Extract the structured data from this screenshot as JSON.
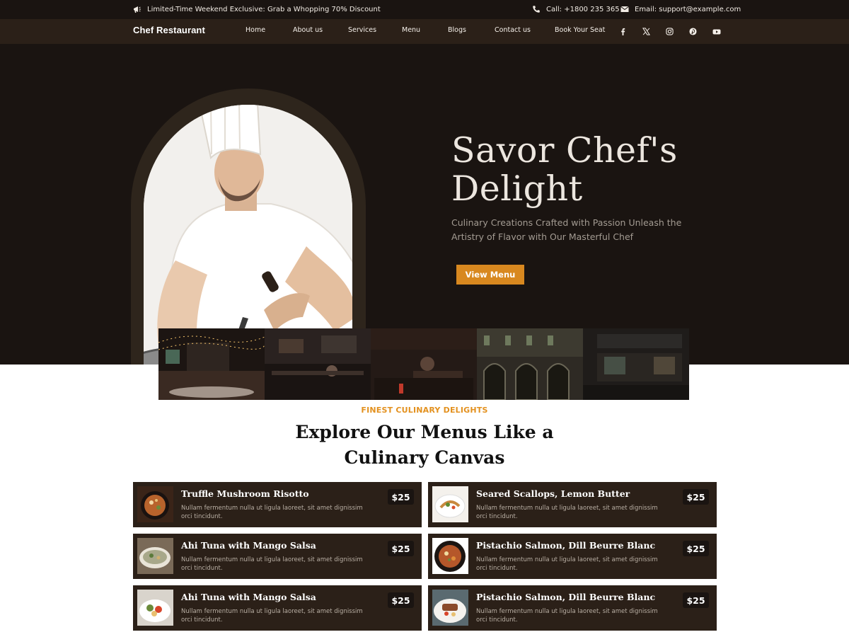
{
  "topbar": {
    "promo": "Limited-Time Weekend Exclusive: Grab a Whopping 70% Discount",
    "phone": "Call: +1800 235 365",
    "email": "Email: support@example.com"
  },
  "nav": {
    "brand": "Chef Restaurant",
    "links": [
      "Home",
      "About us",
      "Services",
      "Menu",
      "Blogs",
      "Contact us",
      "Book Your Seat"
    ],
    "socials": [
      "facebook-icon",
      "x-twitter-icon",
      "instagram-icon",
      "pinterest-icon",
      "youtube-icon"
    ]
  },
  "hero": {
    "title_line1": "Savor Chef's",
    "title_line2": "Delight",
    "subtitle": "Culinary Creations Crafted with Passion Unleash the Artistry of Flavor with Our Masterful Chef",
    "button": "View Menu"
  },
  "menu_section": {
    "eyebrow": "FINEST CULINARY DELIGHTS",
    "title_line1": "Explore Our Menus Like a",
    "title_line2": "Culinary Canvas"
  },
  "menu_items": [
    {
      "name": "Truffle Mushroom Risotto",
      "desc": "Nullam fermentum nulla ut ligula laoreet, sit amet dignissim orci tincidunt.",
      "price": "$25"
    },
    {
      "name": "Seared Scallops, Lemon Butter",
      "desc": "Nullam fermentum nulla ut ligula laoreet, sit amet dignissim orci tincidunt.",
      "price": "$25"
    },
    {
      "name": "Ahi Tuna with Mango Salsa",
      "desc": "Nullam fermentum nulla ut ligula laoreet, sit amet dignissim orci tincidunt.",
      "price": "$25"
    },
    {
      "name": "Pistachio Salmon, Dill Beurre Blanc",
      "desc": "Nullam fermentum nulla ut ligula laoreet, sit amet dignissim orci tincidunt.",
      "price": "$25"
    },
    {
      "name": "Ahi Tuna with Mango Salsa",
      "desc": "Nullam fermentum nulla ut ligula laoreet, sit amet dignissim orci tincidunt.",
      "price": "$25"
    },
    {
      "name": "Pistachio Salmon, Dill Beurre Blanc",
      "desc": "Nullam fermentum nulla ut ligula laoreet, sit amet dignissim orci tincidunt.",
      "price": "$25"
    }
  ],
  "colors": {
    "dark_bg": "#1a1411",
    "nav_bg": "#2b2018",
    "accent": "#d8881f",
    "eyebrow": "#e3911f"
  }
}
